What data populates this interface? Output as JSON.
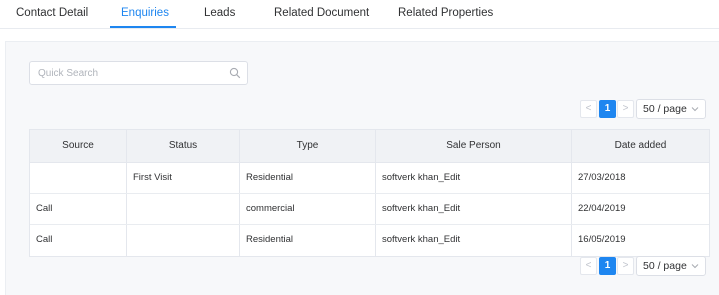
{
  "tabs": [
    {
      "label": "Contact Detail",
      "active": false
    },
    {
      "label": "Enquiries",
      "active": true
    },
    {
      "label": "Leads",
      "active": false
    },
    {
      "label": "Related Document",
      "active": false
    },
    {
      "label": "Related Properties",
      "active": false
    }
  ],
  "search": {
    "placeholder": "Quick Search",
    "icon": "search-icon"
  },
  "pagination": {
    "prev": "<",
    "current_page": "1",
    "next": ">",
    "page_size": "50 / page"
  },
  "table": {
    "columns": [
      "Source",
      "Status",
      "Type",
      "Sale Person",
      "Date added"
    ],
    "rows": [
      [
        "",
        "First Visit",
        "Residential",
        "softverk khan_Edit",
        "27/03/2018"
      ],
      [
        "Call",
        "",
        "commercial",
        "softverk khan_Edit",
        "22/04/2019"
      ],
      [
        "Call",
        "",
        "Residential",
        "softverk khan_Edit",
        "16/05/2019"
      ]
    ]
  },
  "colors": {
    "accent": "#1e86f0",
    "header_bg": "#f0f2f5",
    "panel_bg": "#f7f8fa"
  }
}
